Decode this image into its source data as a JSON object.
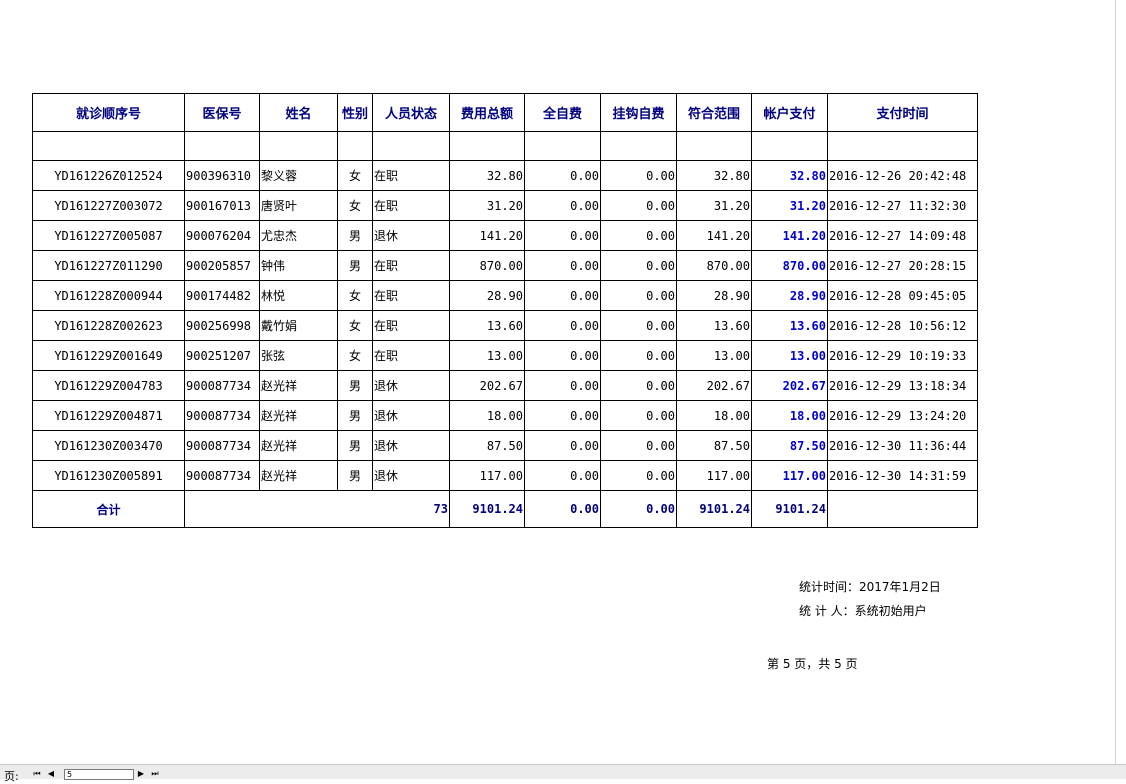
{
  "table": {
    "headers": [
      "就诊顺序号",
      "医保号",
      "姓名",
      "性别",
      "人员状态",
      "费用总额",
      "全自费",
      "挂钩自费",
      "符合范围",
      "帐户支付",
      "支付时间"
    ],
    "rows": [
      [
        "YD161226Z012524",
        "900396310",
        "黎义蓉",
        "女",
        "在职",
        "32.80",
        "0.00",
        "0.00",
        "32.80",
        "32.80",
        "2016-12-26 20:42:48"
      ],
      [
        "YD161227Z003072",
        "900167013",
        "唐贤叶",
        "女",
        "在职",
        "31.20",
        "0.00",
        "0.00",
        "31.20",
        "31.20",
        "2016-12-27 11:32:30"
      ],
      [
        "YD161227Z005087",
        "900076204",
        "尤忠杰",
        "男",
        "退休",
        "141.20",
        "0.00",
        "0.00",
        "141.20",
        "141.20",
        "2016-12-27 14:09:48"
      ],
      [
        "YD161227Z011290",
        "900205857",
        "钟伟",
        "男",
        "在职",
        "870.00",
        "0.00",
        "0.00",
        "870.00",
        "870.00",
        "2016-12-27 20:28:15"
      ],
      [
        "YD161228Z000944",
        "900174482",
        "林悦",
        "女",
        "在职",
        "28.90",
        "0.00",
        "0.00",
        "28.90",
        "28.90",
        "2016-12-28 09:45:05"
      ],
      [
        "YD161228Z002623",
        "900256998",
        "戴竹娟",
        "女",
        "在职",
        "13.60",
        "0.00",
        "0.00",
        "13.60",
        "13.60",
        "2016-12-28 10:56:12"
      ],
      [
        "YD161229Z001649",
        "900251207",
        "张弦",
        "女",
        "在职",
        "13.00",
        "0.00",
        "0.00",
        "13.00",
        "13.00",
        "2016-12-29 10:19:33"
      ],
      [
        "YD161229Z004783",
        "900087734",
        "赵光祥",
        "男",
        "退休",
        "202.67",
        "0.00",
        "0.00",
        "202.67",
        "202.67",
        "2016-12-29 13:18:34"
      ],
      [
        "YD161229Z004871",
        "900087734",
        "赵光祥",
        "男",
        "退休",
        "18.00",
        "0.00",
        "0.00",
        "18.00",
        "18.00",
        "2016-12-29 13:24:20"
      ],
      [
        "YD161230Z003470",
        "900087734",
        "赵光祥",
        "男",
        "退休",
        "87.50",
        "0.00",
        "0.00",
        "87.50",
        "87.50",
        "2016-12-30 11:36:44"
      ],
      [
        "YD161230Z005891",
        "900087734",
        "赵光祥",
        "男",
        "退休",
        "117.00",
        "0.00",
        "0.00",
        "117.00",
        "117.00",
        "2016-12-30 14:31:59"
      ]
    ],
    "total": {
      "label": "合计",
      "count": "73",
      "total_fee": "9101.24",
      "full_self": "0.00",
      "linked_self": "0.00",
      "in_scope": "9101.24",
      "account_pay": "9101.24"
    }
  },
  "footer": {
    "stat_time": "统计时间：2017年1月2日",
    "stat_user": "统 计 人：系统初始用户",
    "page_info": "第 5 页，共 5 页"
  },
  "statusbar": {
    "page_label": "页:",
    "page_value": "5"
  }
}
